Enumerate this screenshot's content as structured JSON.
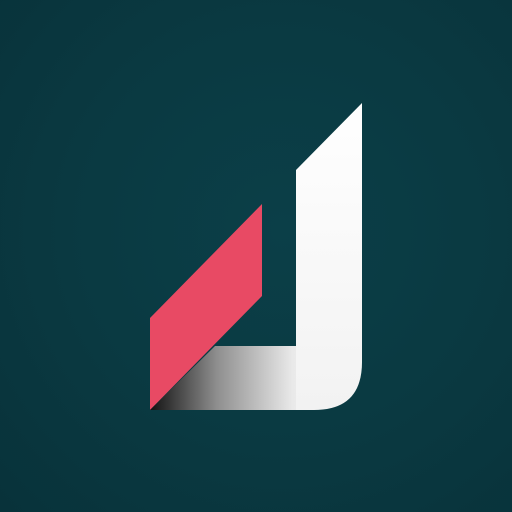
{
  "logo": {
    "icon": "stylized-letter-j-logo-icon",
    "colors": {
      "background": "#0a3a44",
      "accent": "#e84a64",
      "white": "#f7f7f7",
      "shadow": "#1a1a1a"
    }
  }
}
